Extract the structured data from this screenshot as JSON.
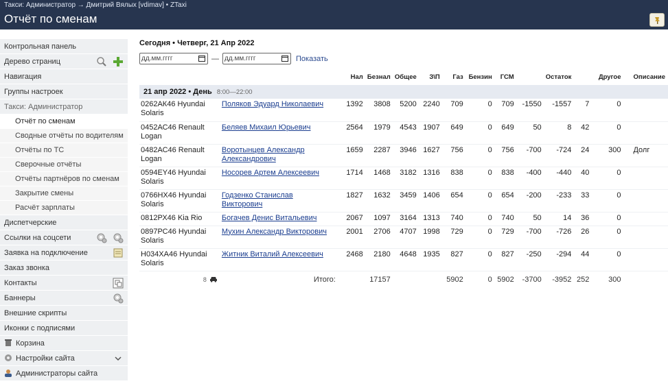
{
  "header": {
    "breadcrumb": "Такси: Администратор → Дмитрий Вялых [vdimav] • ZTaxi",
    "title": "Отчёт по сменам"
  },
  "sidebar": {
    "items": [
      {
        "label": "Контрольная панель"
      },
      {
        "label": "Дерево страниц",
        "icons": [
          "search-icon",
          "add-icon"
        ]
      },
      {
        "label": "Навигация"
      },
      {
        "label": "Группы настроек"
      },
      {
        "label": "Такси: Администратор"
      },
      {
        "label": "Отчёт по сменам"
      },
      {
        "label": "Сводные отчёты по водителям"
      },
      {
        "label": "Отчёты по ТС"
      },
      {
        "label": "Сверочные отчёты"
      },
      {
        "label": "Отчёты партнёров по сменам"
      },
      {
        "label": "Закрытие смены"
      },
      {
        "label": "Расчёт зарплаты"
      },
      {
        "label": "Диспетчерские"
      },
      {
        "label": "Ссылки на соцсети",
        "icons": [
          "gear-icon",
          "gear-icon"
        ]
      },
      {
        "label": "Заявка на подключение",
        "icons": [
          "document-icon"
        ]
      },
      {
        "label": "Заказ звонка"
      },
      {
        "label": "Контакты",
        "icons": [
          "copy-icon"
        ]
      },
      {
        "label": "Баннеры",
        "icons": [
          "gear-icon"
        ]
      },
      {
        "label": "Внешние скрипты"
      },
      {
        "label": "Иконки с подписями"
      },
      {
        "label": "Корзина",
        "icons": [
          "trash-icon"
        ]
      },
      {
        "label": "Настройки сайта",
        "icons": [
          "settings-icon",
          "chevron-down-icon"
        ]
      },
      {
        "label": "Администраторы сайта",
        "icons": [
          "user-icon"
        ]
      }
    ]
  },
  "content": {
    "today": "Сегодня • Четверг, 21 Апр 2022",
    "date_from_placeholder": "дд.мм.гггг",
    "date_to_placeholder": "дд.мм.гггг",
    "dash": "—",
    "show_label": "Показать",
    "columns": [
      "Нал",
      "Безнал",
      "Общее",
      "З\\П",
      "Газ",
      "Бензин",
      "ГСМ",
      "Остаток",
      "Другое",
      "Описание"
    ],
    "day": {
      "label": "21 апр 2022 • День",
      "time": "8:00—22:00"
    },
    "rows": [
      {
        "car": "0262АК46 Hyundai Solaris",
        "driver": "Поляков Эдуард Николаевич",
        "nal": "1392",
        "beznal": "3808",
        "total": "5200",
        "zp": "2240",
        "gas": "709",
        "benzin": "0",
        "gsm": "709",
        "rest1": "-1550",
        "rest2": "-1557",
        "rest3": "7",
        "other": "0",
        "desc": ""
      },
      {
        "car": "0452АС46 Renault Logan",
        "driver": "Беляев Михаил Юрьевич",
        "nal": "2564",
        "beznal": "1979",
        "total": "4543",
        "zp": "1907",
        "gas": "649",
        "benzin": "0",
        "gsm": "649",
        "rest1": "50",
        "rest2": "8",
        "rest3": "42",
        "other": "0",
        "desc": ""
      },
      {
        "car": "0482АС46 Renault Logan",
        "driver": "Воротынцев Александр Александрович",
        "nal": "1659",
        "beznal": "2287",
        "total": "3946",
        "zp": "1627",
        "gas": "756",
        "benzin": "0",
        "gsm": "756",
        "rest1": "-700",
        "rest2": "-724",
        "rest3": "24",
        "other": "300",
        "desc": "Долг"
      },
      {
        "car": "0594ЕY46 Hyundai Solaris",
        "driver": "Носорев Артем Алексеевич",
        "nal": "1714",
        "beznal": "1468",
        "total": "3182",
        "zp": "1316",
        "gas": "838",
        "benzin": "0",
        "gsm": "838",
        "rest1": "-400",
        "rest2": "-440",
        "rest3": "40",
        "other": "0",
        "desc": ""
      },
      {
        "car": "0766НХ46 Hyundai Solaris",
        "driver": "Годзенко Станислав Викторович",
        "nal": "1827",
        "beznal": "1632",
        "total": "3459",
        "zp": "1406",
        "gas": "654",
        "benzin": "0",
        "gsm": "654",
        "rest1": "-200",
        "rest2": "-233",
        "rest3": "33",
        "other": "0",
        "desc": ""
      },
      {
        "car": "0812РХ46 Kia Rio",
        "driver": "Богачев Денис Витальевич",
        "nal": "2067",
        "beznal": "1097",
        "total": "3164",
        "zp": "1313",
        "gas": "740",
        "benzin": "0",
        "gsm": "740",
        "rest1": "50",
        "rest2": "14",
        "rest3": "36",
        "other": "0",
        "desc": ""
      },
      {
        "car": "0897РС46 Hyundai Solaris",
        "driver": "Мухин Александр Викторович",
        "nal": "2001",
        "beznal": "2706",
        "total": "4707",
        "zp": "1998",
        "gas": "729",
        "benzin": "0",
        "gsm": "729",
        "rest1": "-700",
        "rest2": "-726",
        "rest3": "26",
        "other": "0",
        "desc": ""
      },
      {
        "car": "Н034ХА46 Hyundai Solaris",
        "driver": "Житник Виталий Алексеевич",
        "nal": "2468",
        "beznal": "2180",
        "total": "4648",
        "zp": "1935",
        "gas": "827",
        "benzin": "0",
        "gsm": "827",
        "rest1": "-250",
        "rest2": "-294",
        "rest3": "44",
        "other": "0",
        "desc": ""
      }
    ],
    "totals": {
      "count": "8",
      "label": "Итого:",
      "beznal": "17157",
      "gas": "5902",
      "benzin": "0",
      "gsm": "5902",
      "rest1": "-3700",
      "rest2": "-3952",
      "rest3": "252",
      "other": "300"
    }
  }
}
